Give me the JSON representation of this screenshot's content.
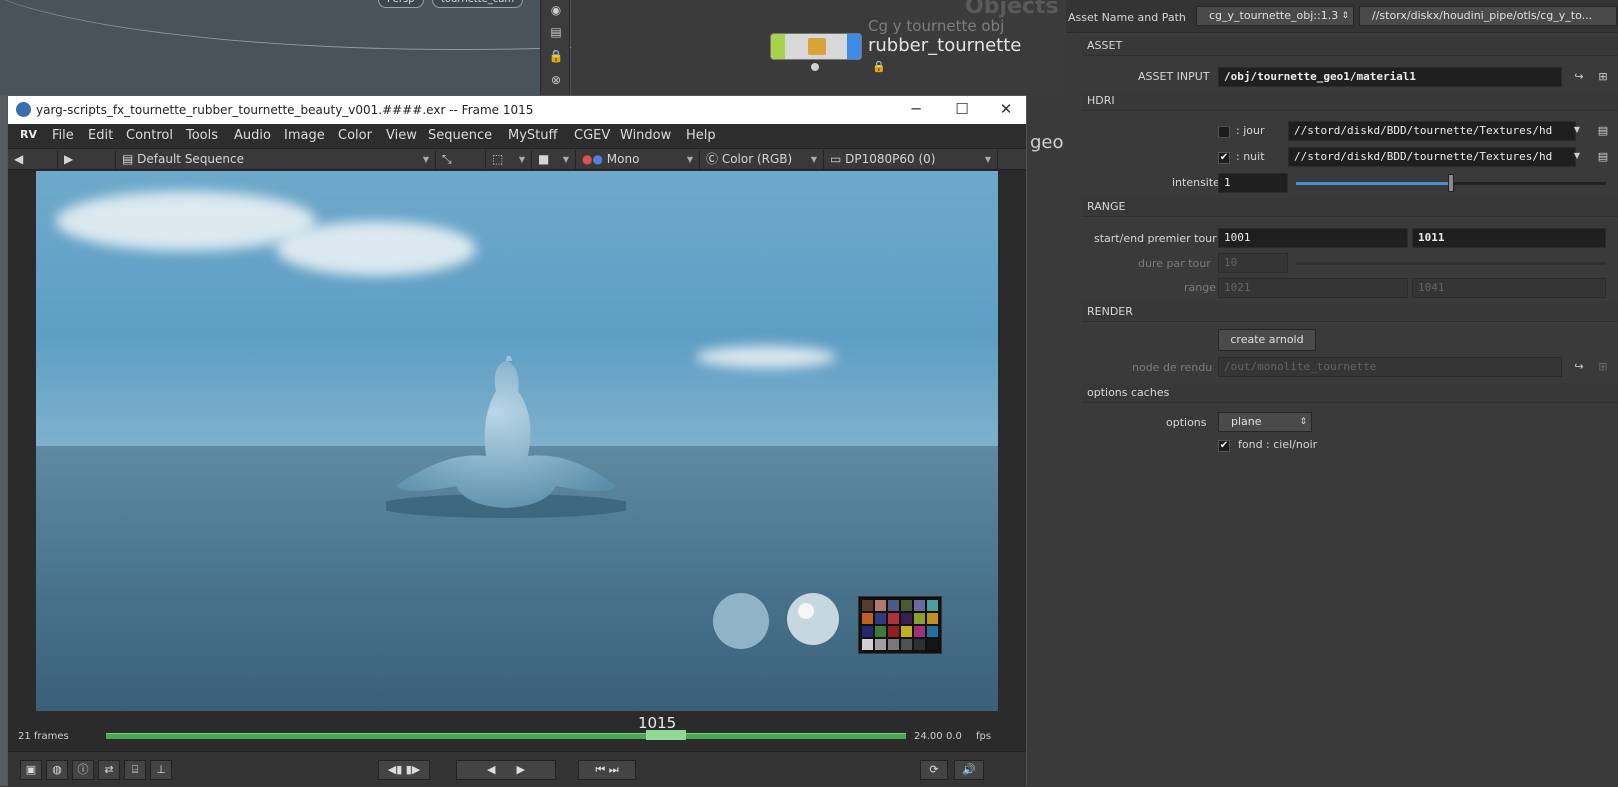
{
  "network": {
    "pill1": "Persp",
    "pill2": "tournette_cam",
    "objects_label": "Objects",
    "node_subtitle": "Cg y tournette obj",
    "node_name": "rubber_tournette",
    "geo_label": "geo"
  },
  "rv": {
    "title": "yarg-scripts_fx_tournette_rubber_tournette_beauty_v001.####.exr -- Frame 1015",
    "logo": "RV",
    "menu": [
      "File",
      "Edit",
      "Control",
      "Tools",
      "Audio",
      "Image",
      "Color",
      "View",
      "Sequence",
      "MyStuff",
      "CGEV",
      "Window",
      "Help"
    ],
    "toolbar": {
      "sequence": "Default Sequence",
      "channel": "Mono",
      "color": "Color (RGB)",
      "display": "DP1080P60 (0)"
    },
    "timeline": {
      "frames": "21 frames",
      "current_frame": "1015",
      "fps_value": "24.00",
      "fps_offset": "0.0",
      "fps_label": "fps",
      "cursor_fraction": 0.7
    }
  },
  "panel": {
    "asset_name_label": "Asset Name and Path",
    "asset_name": "cg_y_tournette_obj::1.3",
    "asset_path": "//storx/diskx/houdini_pipe/otls/cg_y_to...",
    "sections": {
      "asset": "ASSET",
      "hdri": "HDRI",
      "range": "RANGE",
      "render": "RENDER",
      "options_caches": "options caches"
    },
    "asset_input_label": "ASSET INPUT",
    "asset_input_value": "/obj/tournette_geo1/material1",
    "jour_label": "jour",
    "jour_value": "//stord/diskd/BDD/tournette/Textures/hd",
    "jour_checked": false,
    "nuit_label": "nuit",
    "nuit_value": "//stord/diskd/BDD/tournette/Textures/hd",
    "nuit_checked": true,
    "intensite_label": "intensite",
    "intensite_value": "1",
    "intensite_fraction": 0.5,
    "start_end_label": "start/end premier tour",
    "start_value": "1001",
    "end_value": "1011",
    "dure_label": "dure par tour",
    "dure_value": "10",
    "range_label": "range",
    "range_start": "1021",
    "range_end": "1041",
    "create_button": "create arnold",
    "node_rendu_label": "node de rendu",
    "node_rendu_value": "/out/monolite_tournette",
    "options_label": "options",
    "options_value": "plane",
    "fond_label": "fond : ciel/noir",
    "fond_checked": true
  }
}
